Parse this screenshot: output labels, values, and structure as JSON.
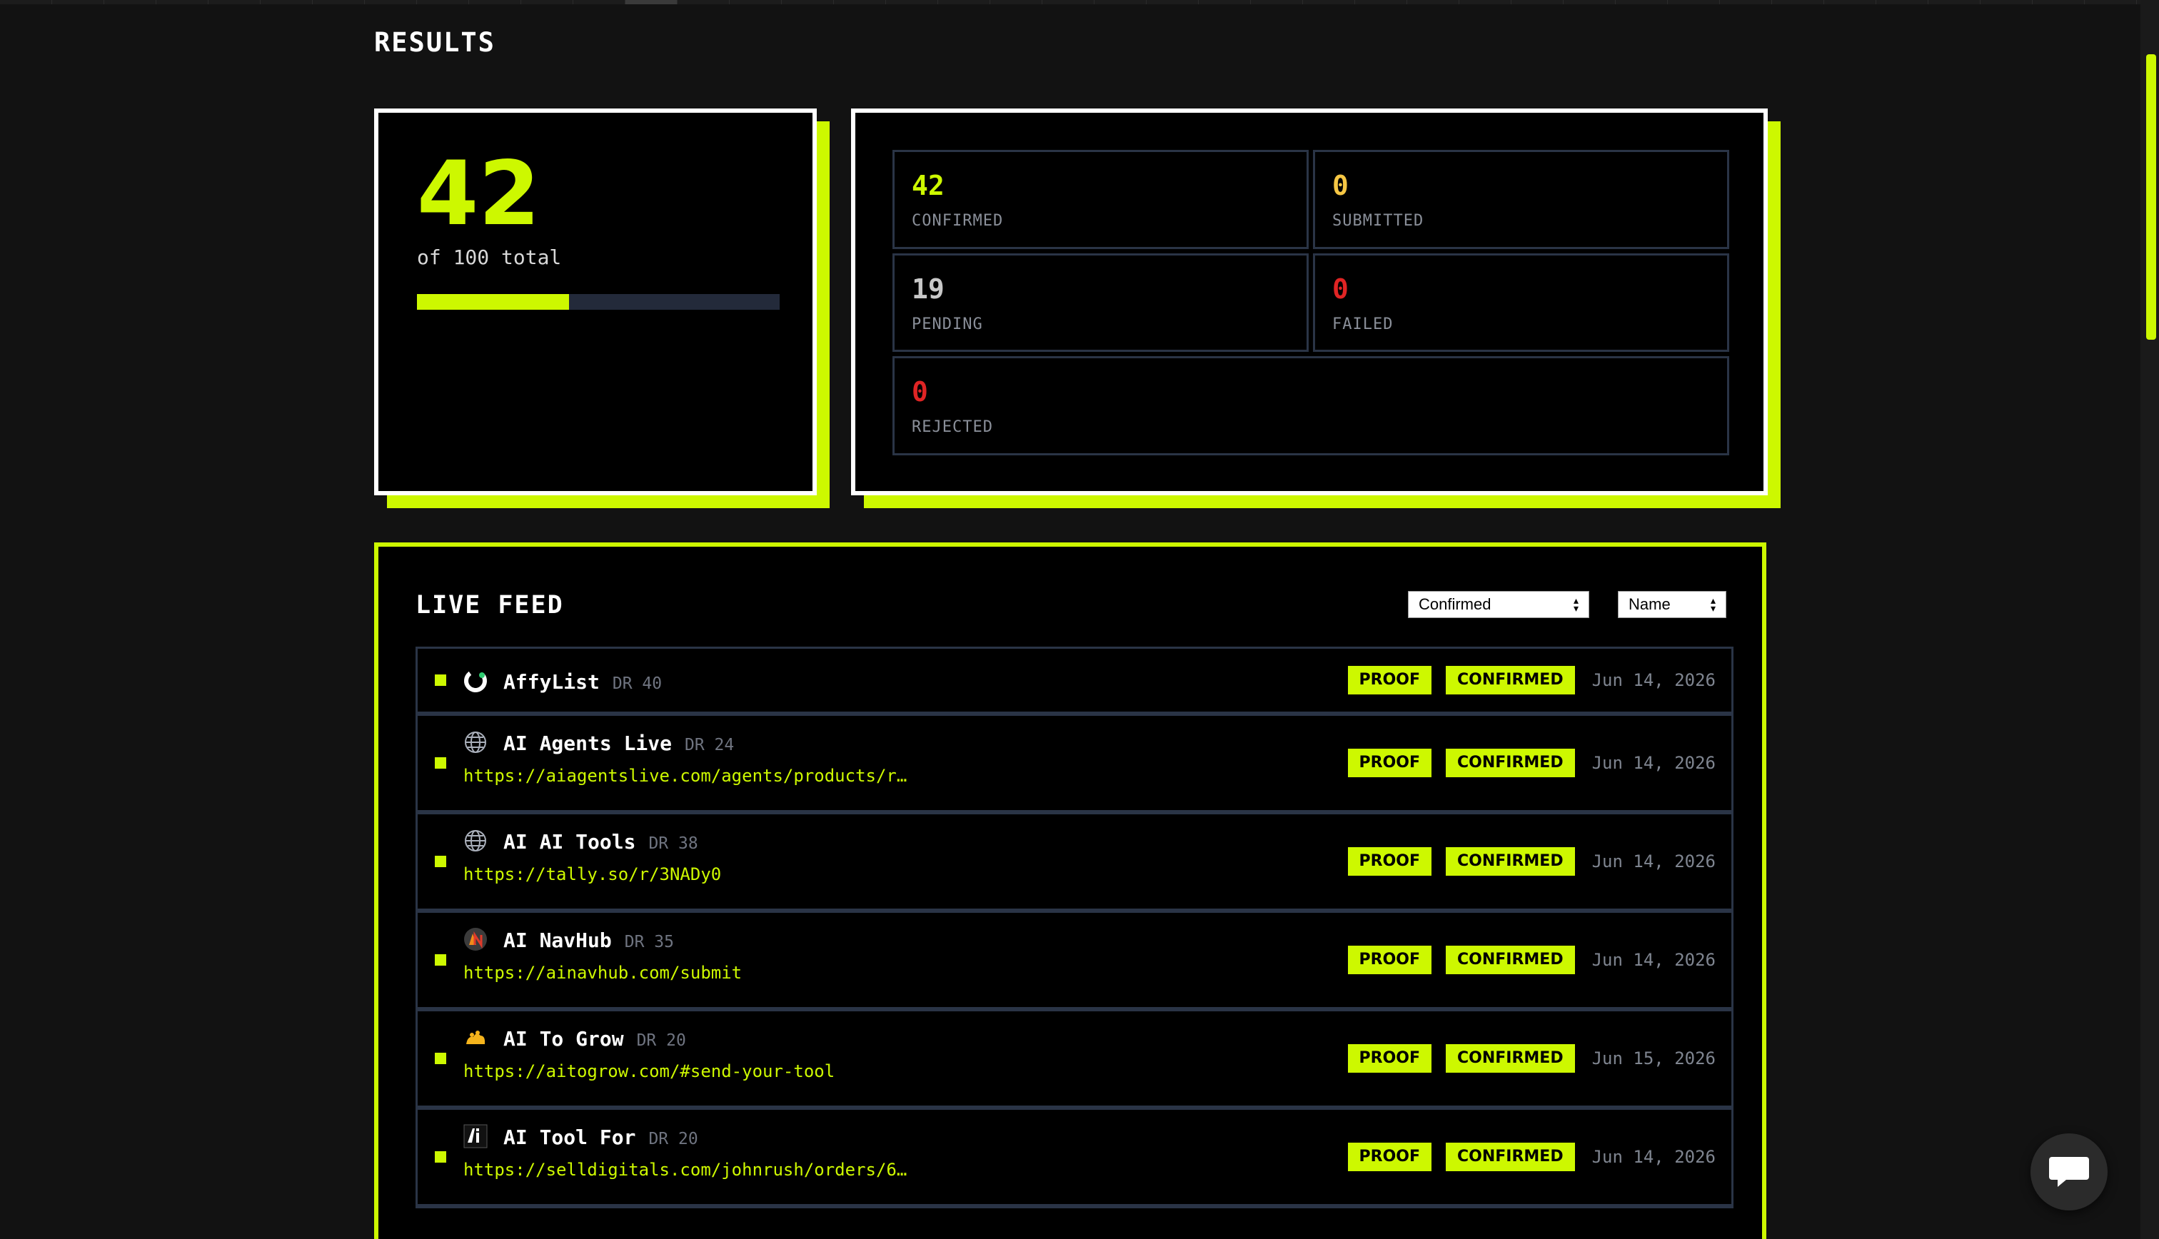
{
  "header": {
    "title": "RESULTS"
  },
  "summary": {
    "count": "42",
    "of_total": "of 100 total",
    "progress_fraction": 0.42
  },
  "stats": [
    {
      "value": "0",
      "label": "SUBMITTED",
      "color": "#f6c744"
    },
    {
      "value": "42",
      "label": "CONFIRMED",
      "color": "#cdf800"
    },
    {
      "value": "19",
      "label": "PENDING",
      "color": "#c8c8c8"
    },
    {
      "value": "0",
      "label": "FAILED",
      "color": "#e02424"
    },
    {
      "value": "0",
      "label": "REJECTED",
      "color": "#e02424"
    }
  ],
  "feed": {
    "title": "LIVE FEED",
    "filter_value": "Confirmed",
    "sort_value": "Name",
    "proof_label": "PROOF",
    "status_label": "CONFIRMED",
    "items": [
      {
        "name": "AffyList",
        "dr": "DR 40",
        "url": "",
        "date": "Jun 14, 2026",
        "icon": "affylist-logo-icon"
      },
      {
        "name": "AI Agents Live",
        "dr": "DR 24",
        "url": "https://aiagentslive.com/agents/products/r…",
        "date": "Jun 14, 2026",
        "icon": "globe-icon"
      },
      {
        "name": "AI AI Tools",
        "dr": "DR 38",
        "url": "https://tally.so/r/3NADy0",
        "date": "Jun 14, 2026",
        "icon": "globe-icon"
      },
      {
        "name": "AI NavHub",
        "dr": "DR 35",
        "url": "https://ainavhub.com/submit",
        "date": "Jun 14, 2026",
        "icon": "ainavhub-logo-icon"
      },
      {
        "name": "AI To Grow",
        "dr": "DR 20",
        "url": "https://aitogrow.com/#send-your-tool",
        "date": "Jun 15, 2026",
        "icon": "aitogrow-logo-icon"
      },
      {
        "name": "AI Tool For",
        "dr": "DR 20",
        "url": "https://selldigitals.com/johnrush/orders/6…",
        "date": "Jun 14, 2026",
        "icon": "aitoolfor-logo-icon"
      }
    ]
  },
  "colors": {
    "accent": "#cdf800",
    "background": "#121212",
    "panel": "#000000",
    "border": "#2a3446"
  }
}
